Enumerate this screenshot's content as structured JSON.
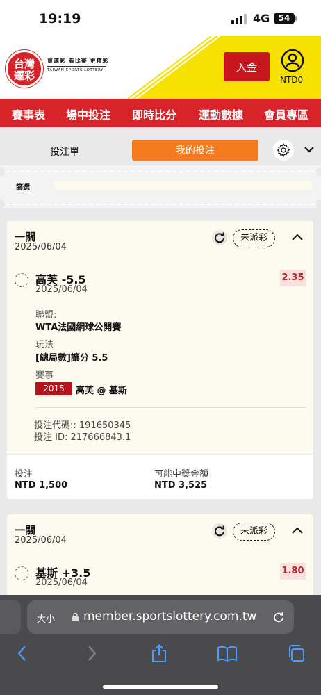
{
  "status_bar": {
    "time": "19:19",
    "network": "4G",
    "battery": "54"
  },
  "header": {
    "logo_text": "台灣\n運彩",
    "slogan": "買運彩 看比賽 更精彩",
    "brand_en": "TAIWAN SPORTS LOTTERY",
    "deposit_label": "入金",
    "balance": "NTD0"
  },
  "nav": [
    "賽事表",
    "場中投注",
    "即時比分",
    "運動數據",
    "會員專區"
  ],
  "tabs": {
    "bet_slip": "投注單",
    "my_bets": "我的投注"
  },
  "filter": {
    "label": "篩選"
  },
  "cards": [
    {
      "type": "一關",
      "date": "2025/06/04",
      "status": "未派彩",
      "pick": "高芙 -5.5",
      "pick_date": "2025/06/04",
      "odds": "2.35",
      "league_label": "聯盟:",
      "league": "WTA法國網球公開賽",
      "market_label": "玩法",
      "market": "[總局數]讓分 5.5",
      "event_label": "賽事",
      "event_no": "2015",
      "event": "高芙 @ 基斯",
      "bet_code": "投注代碼:: 191650345",
      "bet_id": "投注 ID: 217666843.1",
      "stake_label": "投注",
      "stake": "NTD 1,500",
      "payout_label": "可能中獎金額",
      "payout": "NTD 3,525"
    },
    {
      "type": "一關",
      "date": "2025/06/04",
      "status": "未派彩",
      "pick": "基斯 +3.5",
      "pick_date": "2025/06/04",
      "odds": "1.80"
    }
  ],
  "browser": {
    "text_size": "大小",
    "url": "member.sportslottery.com.tw"
  },
  "colors": {
    "brand_red": "#d8232a",
    "accent_orange": "#f47b20",
    "yellow": "#f7e100"
  }
}
